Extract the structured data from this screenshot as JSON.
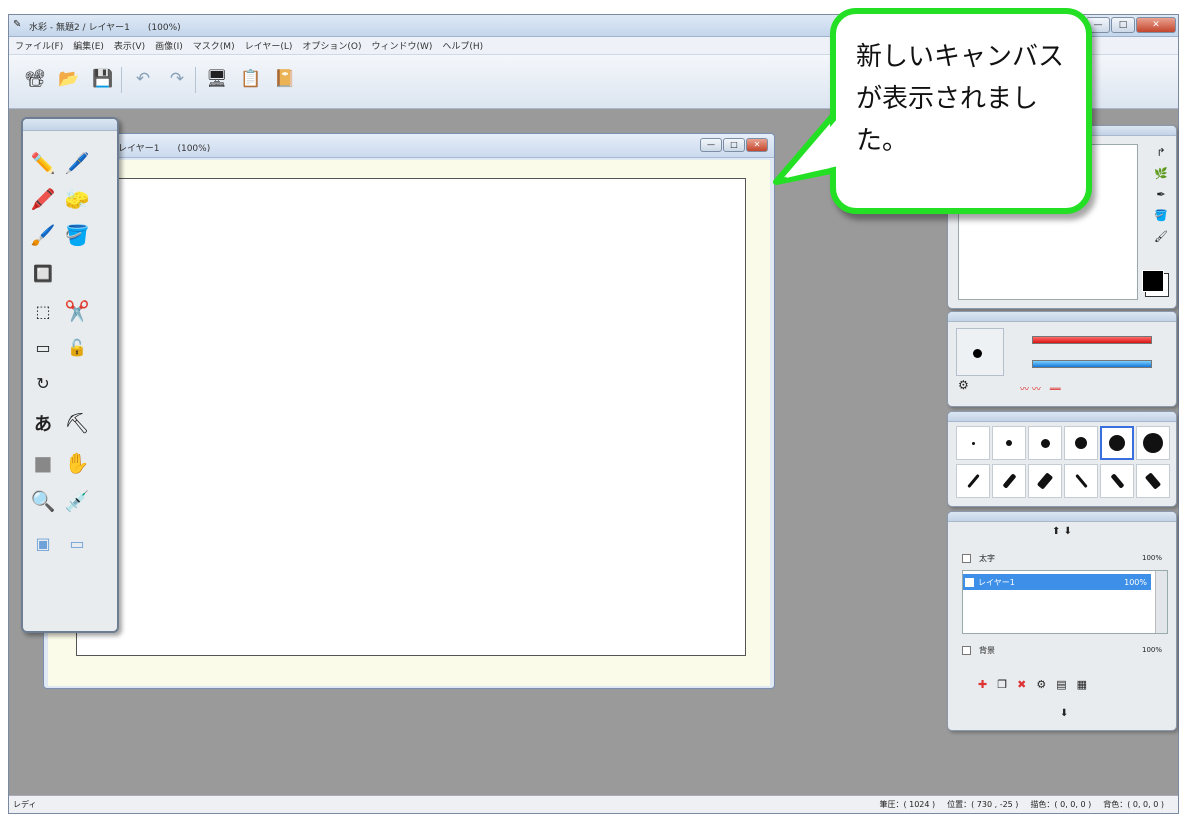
{
  "window": {
    "title": "水彩 - 無題2 / レイヤー1　　(100%)",
    "btn_min": "—",
    "btn_max": "□",
    "btn_close": "✕"
  },
  "menu": [
    "ファイル(F)",
    "編集(E)",
    "表示(V)",
    "画像(I)",
    "マスク(M)",
    "レイヤー(L)",
    "オプション(O)",
    "ウィンドウ(W)",
    "ヘルプ(H)"
  ],
  "toolbar": {
    "icons": [
      "📽",
      "📂",
      "💾",
      "↶",
      "↷",
      "🖥",
      "📋",
      "📔"
    ]
  },
  "canvas_window": {
    "title": "レイヤー1　　(100%)",
    "btn_min": "—",
    "btn_max": "□",
    "btn_close": "✕"
  },
  "layers": {
    "top_label": "太字",
    "top_opacity": "100%",
    "selected_label": "レイヤー1",
    "selected_opacity": "100%",
    "bottom_label": "背景",
    "bottom_opacity": "100%"
  },
  "statusbar": {
    "left": "レディ",
    "right": [
      "筆圧：( 1024 )",
      "位置：( 730 , -25 )",
      "描色：( 0, 0, 0 )",
      "背色：( 0, 0, 0 )"
    ]
  },
  "callout": {
    "text": "新しいキャンバスが表示されました。"
  },
  "colors": {
    "callout_border": "#24e024",
    "selected_layer": "#3d8fe8"
  }
}
